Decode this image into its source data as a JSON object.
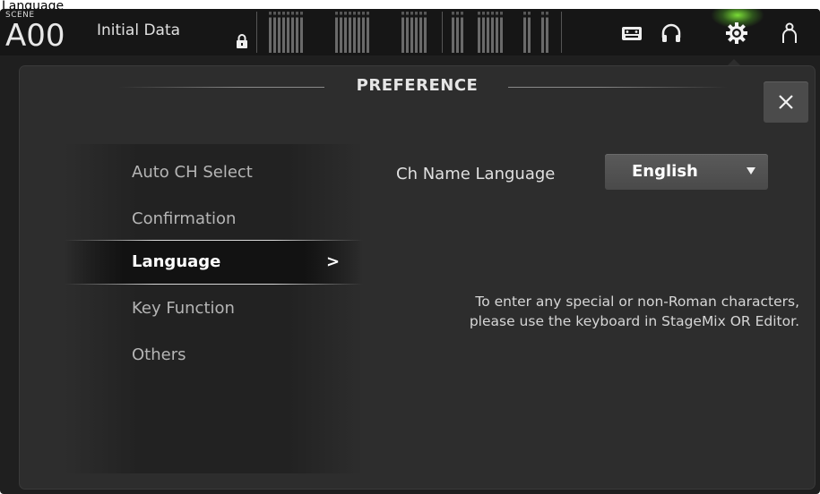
{
  "topbar": {
    "scene_label": "SCENE",
    "scene_number": "A00",
    "scene_title": "Initial Data",
    "icons": [
      "lock-icon",
      "recorder-icon",
      "headphones-icon",
      "gear-icon",
      "user-icon"
    ],
    "active_icon": "gear-icon",
    "accent_color": "#8cff3c"
  },
  "dialog": {
    "title": "PREFERENCE",
    "close_label": "✕"
  },
  "menu": {
    "items": [
      {
        "label": "Auto CH Select"
      },
      {
        "label": "Confirmation"
      },
      {
        "label": "Language",
        "selected": true,
        "arrow": ">"
      },
      {
        "label": "Key Function"
      },
      {
        "label": "Others"
      }
    ]
  },
  "language": {
    "field_label": "Ch Name Language",
    "selected_value": "English",
    "note_line1": "To enter any special or non-Roman characters,",
    "note_line2": "please use the keyboard in StageMix OR Editor."
  }
}
